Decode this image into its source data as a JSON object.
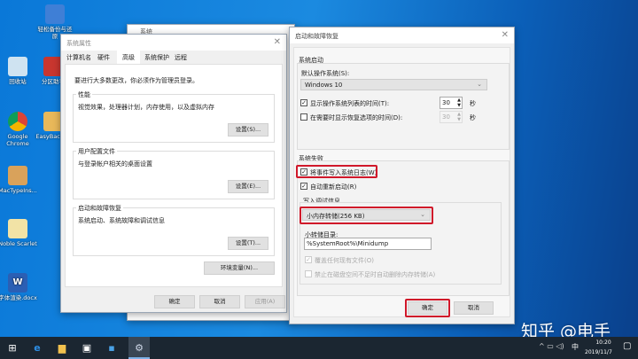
{
  "desktop": {
    "icons": [
      {
        "label": "轻松备份与还原",
        "color": "#3f7fd6"
      },
      {
        "label": "回收站",
        "color": "#cfe3f1"
      },
      {
        "label": "分区助手",
        "color": "#c8362f"
      },
      {
        "label": "Google Chrome",
        "color": "#e6b22b"
      },
      {
        "label": "EasyBackup",
        "color": "#e8b85a"
      },
      {
        "label": "MacTypeIns...",
        "color": "#d9a25b"
      },
      {
        "label": "Noble Scarlet",
        "color": "#f2e3a6"
      },
      {
        "label": "字体渲染.docx",
        "color": "#2b5fb4"
      }
    ]
  },
  "system_window": {
    "title": "系统"
  },
  "sysprops": {
    "title": "系统属性",
    "tabs": [
      "计算机名",
      "硬件",
      "高级",
      "系统保护",
      "远程"
    ],
    "active_tab": 2,
    "admin_note": "要进行大多数更改，你必须作为管理员登录。",
    "performance": {
      "label": "性能",
      "desc": "视觉效果，处理器计划，内存使用，以及虚拟内存",
      "button": "设置(S)..."
    },
    "profile": {
      "label": "用户配置文件",
      "desc": "与登录帐户相关的桌面设置",
      "button": "设置(E)..."
    },
    "startup": {
      "label": "启动和故障恢复",
      "desc": "系统启动、系统故障和调试信息",
      "button": "设置(T)..."
    },
    "env_button": "环境变量(N)...",
    "ok": "确定",
    "cancel": "取消",
    "apply": "应用(A)"
  },
  "recovery": {
    "title": "启动和故障恢复",
    "startup_group": "系统启动",
    "default_os_label": "默认操作系统(S):",
    "default_os": "Windows 10",
    "show_list": {
      "label": "显示操作系统列表的时间(T):",
      "checked": true,
      "value": "30",
      "unit": "秒"
    },
    "show_recovery": {
      "label": "在需要时显示恢复选项的时间(D):",
      "checked": false,
      "value": "30",
      "unit": "秒"
    },
    "failure_group": "系统失败",
    "write_event": {
      "label": "将事件写入系统日志(W)",
      "checked": true
    },
    "auto_restart": {
      "label": "自动重新启动(R)",
      "checked": true
    },
    "debug_group": "写入调试信息",
    "debug_type": "小内存转储(256 KB)",
    "dump_dir_label": "小转储目录:",
    "dump_dir": "%SystemRoot%\\Minidump",
    "overwrite": {
      "label": "覆盖任何现有文件(O)",
      "checked": true
    },
    "disable_auto_delete": {
      "label": "禁止在磁盘空间不足时自动删除内存转储(A)",
      "checked": false
    },
    "ok": "确定",
    "cancel": "取消"
  },
  "watermark": "知乎 @电手",
  "taskbar": {
    "tray_ime": "中",
    "time": "10:20",
    "date": "2019/11/7"
  },
  "colors": {
    "highlight": "#d0182a",
    "taskbar": "#1b2631"
  }
}
